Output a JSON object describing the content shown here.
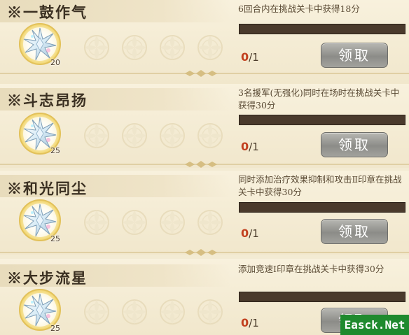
{
  "colors": {
    "background": "#f3ebd3",
    "title_text": "#3b3022",
    "progress_current": "#c2401f",
    "bar_track": "#4a3a2c",
    "claim_button": "#9c9c98",
    "watermark_bg": "#1f8a2e"
  },
  "quests": [
    {
      "title": "※一鼓作气",
      "desc": "6回合内在挑战关卡中获得18分",
      "progress_current": "0",
      "progress_total": "/1",
      "progress_fraction": 0,
      "claim_label": "领取",
      "reward_count": "20",
      "reward_icon": "star-crystal-icon"
    },
    {
      "title": "※斗志昂扬",
      "desc": "3名援军(无强化)同时在场时在挑战关卡中获得30分",
      "progress_current": "0",
      "progress_total": "/1",
      "progress_fraction": 0,
      "claim_label": "领取",
      "reward_count": "25",
      "reward_icon": "star-crystal-icon"
    },
    {
      "title": "※和光同尘",
      "desc": "同时添加治疗效果抑制和攻击Ⅱ印章在挑战关卡中获得30分",
      "progress_current": "0",
      "progress_total": "/1",
      "progress_fraction": 0,
      "claim_label": "领取",
      "reward_count": "25",
      "reward_icon": "star-crystal-icon"
    },
    {
      "title": "※大步流星",
      "desc": "添加竞速Ⅰ印章在挑战关卡中获得30分",
      "progress_current": "0",
      "progress_total": "/1",
      "progress_fraction": 0,
      "claim_label": "领取",
      "reward_count": "25",
      "reward_icon": "star-crystal-icon"
    }
  ],
  "watermark": "Easck.Net"
}
